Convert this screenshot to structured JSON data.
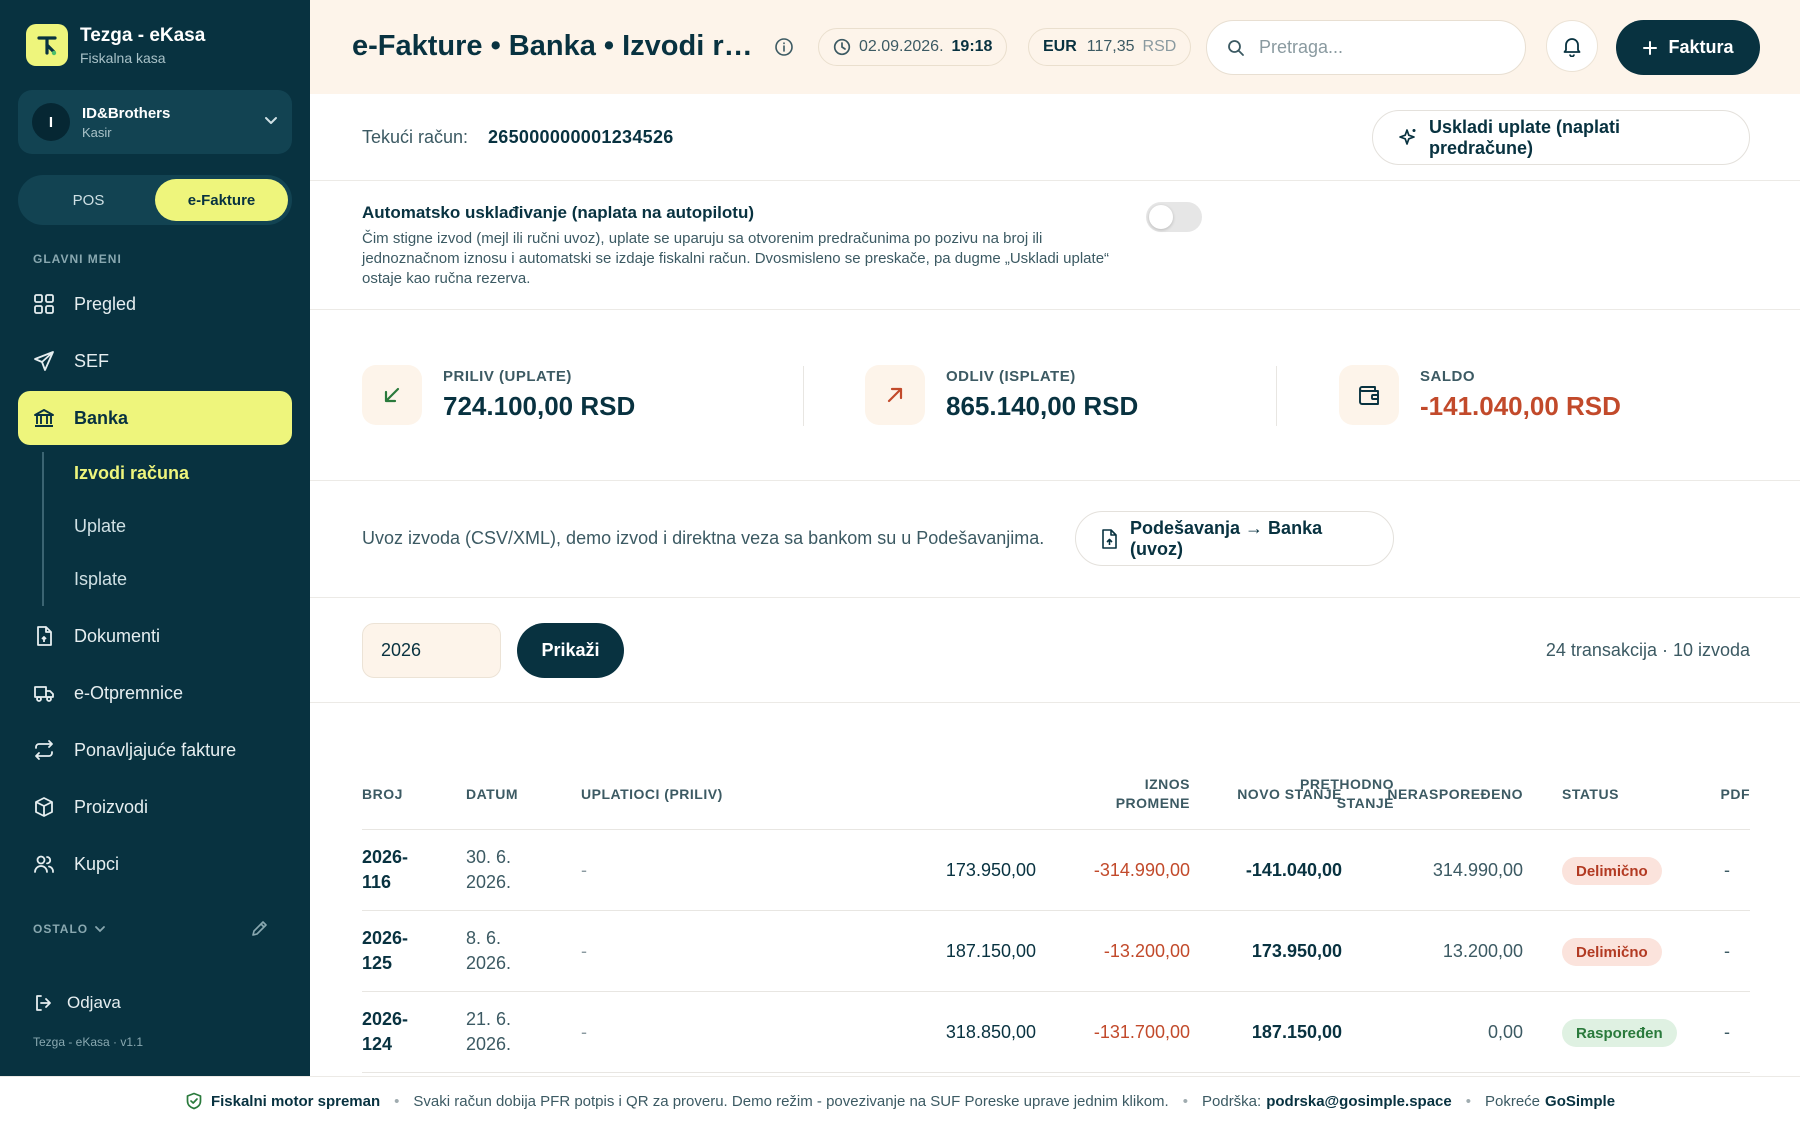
{
  "brand": {
    "title": "Tezga - eKasa",
    "subtitle": "Fiskalna kasa"
  },
  "user": {
    "initial": "I",
    "name": "ID&Brothers",
    "role": "Kasir"
  },
  "mode": {
    "pos": "POS",
    "efakture": "e-Fakture",
    "active": "e-Fakture"
  },
  "sidebar": {
    "section_main": "GLAVNI MENI",
    "items": [
      {
        "label": "Pregled",
        "icon": "grid-icon"
      },
      {
        "label": "SEF",
        "icon": "send-icon"
      },
      {
        "label": "Banka",
        "icon": "bank-icon",
        "active": true
      },
      {
        "label": "Dokumenti",
        "icon": "document-icon"
      },
      {
        "label": "e-Otpremnice",
        "icon": "truck-icon"
      },
      {
        "label": "Ponavljajuće fakture",
        "icon": "repeat-icon"
      },
      {
        "label": "Proizvodi",
        "icon": "box-icon"
      },
      {
        "label": "Kupci",
        "icon": "users-icon"
      }
    ],
    "subitems": [
      {
        "label": "Izvodi računa",
        "active": true
      },
      {
        "label": "Uplate"
      },
      {
        "label": "Isplate"
      }
    ],
    "section_other": "OSTALO",
    "logout": "Odjava",
    "version": "Tezga - eKasa · v1.1"
  },
  "header": {
    "title": "e-Fakture • Banka • Izvodi računa",
    "date": "02.09.2026.",
    "time": "19:18",
    "currency_code": "EUR",
    "currency_rate": "117,35",
    "currency_unit": "RSD",
    "search_placeholder": "Pretraga...",
    "new_button": "Faktura"
  },
  "account": {
    "label": "Tekući račun:",
    "number": "265000000001234526",
    "reconcile_button": "Uskladi uplate (naplati predračune)"
  },
  "auto": {
    "title": "Automatsko usklađivanje (naplata na autopilotu)",
    "description": "Čim stigne izvod (mejl ili ručni uvoz), uplate se uparuju sa otvorenim predračunima po pozivu na broj ili jednoznačnom iznosu i automatski se izdaje fiskalni račun. Dvosmisleno se preskače, pa dugme „Uskladi uplate“ ostaje kao ručna rezerva.",
    "enabled": false
  },
  "stats": {
    "inflow": {
      "label": "PRILIV (UPLATE)",
      "value": "724.100,00 RSD"
    },
    "outflow": {
      "label": "ODLIV (ISPLATE)",
      "value": "865.140,00 RSD"
    },
    "balance": {
      "label": "SALDO",
      "value": "-141.040,00 RSD"
    }
  },
  "import": {
    "text": "Uvoz izvoda (CSV/XML), demo izvod i direktna veza sa bankom su u Podešavanjima.",
    "button": "Podešavanja → Banka (uvoz)"
  },
  "filter": {
    "year": "2026",
    "show_button": "Prikaži",
    "summary": "24 transakcija · 10 izvoda"
  },
  "table": {
    "headers": {
      "broj": "BROJ",
      "datum": "DATUM",
      "uplatioci": "UPLATIOCI (PRILIV)",
      "prethodno_1": "PRETHODNO",
      "prethodno_2": "STANJE",
      "iznos_1": "IZNOS",
      "iznos_2": "PROMENE",
      "novo": "NOVO STANJE",
      "neraspodeljeno": "NERASPOREĐENO",
      "status": "STATUS",
      "pdf": "PDF"
    },
    "rows": [
      {
        "broj_1": "2026-",
        "broj_2": "116",
        "datum_1": "30. 6.",
        "datum_2": "2026.",
        "uplatioci": "-",
        "prethodno": "173.950,00",
        "iznos": "-314.990,00",
        "novo": "-141.040,00",
        "neraspodeljeno": "314.990,00",
        "status": "Delimično",
        "status_type": "partial",
        "pdf": "-"
      },
      {
        "broj_1": "2026-",
        "broj_2": "125",
        "datum_1": "8. 6.",
        "datum_2": "2026.",
        "uplatioci": "-",
        "prethodno": "187.150,00",
        "iznos": "-13.200,00",
        "novo": "173.950,00",
        "neraspodeljeno": "13.200,00",
        "status": "Delimično",
        "status_type": "partial",
        "pdf": "-"
      },
      {
        "broj_1": "2026-",
        "broj_2": "124",
        "datum_1": "21. 6.",
        "datum_2": "2026.",
        "uplatioci": "-",
        "prethodno": "318.850,00",
        "iznos": "-131.700,00",
        "novo": "187.150,00",
        "neraspodeljeno": "0,00",
        "status": "Raspoređen",
        "status_type": "done",
        "pdf": "-"
      }
    ]
  },
  "footer": {
    "status": "Fiskalni motor spreman",
    "message": "Svaki račun dobija PFR potpis i QR za proveru. Demo režim - povezivanje na SUF Poreske uprave jednim klikom.",
    "support_label": "Podrška:",
    "support_email": "podrska@gosimple.space",
    "powered_label": "Pokreće",
    "powered_by": "GoSimple"
  },
  "colors": {
    "sidebar": "#083240",
    "accent": "#eef57c",
    "header_bg": "#fdf4ea",
    "negative": "#c24a2b",
    "positive": "#2a7a3c"
  }
}
